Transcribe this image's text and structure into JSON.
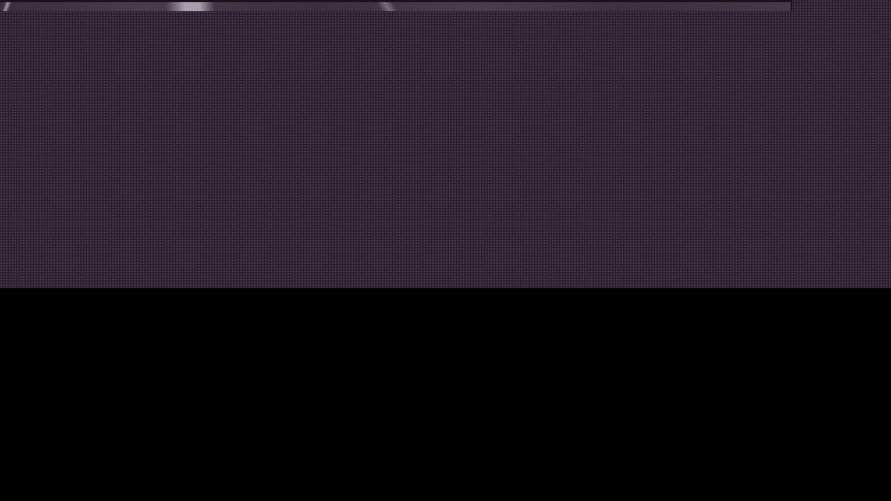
{
  "page": {
    "background_color": "#000000",
    "pattern_color": "#2a1f2c",
    "pattern_dot_color": "#785a7d",
    "banner_strip_color": "#3f3142"
  },
  "banner": {
    "image_semantic": "cropped-banner-image"
  }
}
